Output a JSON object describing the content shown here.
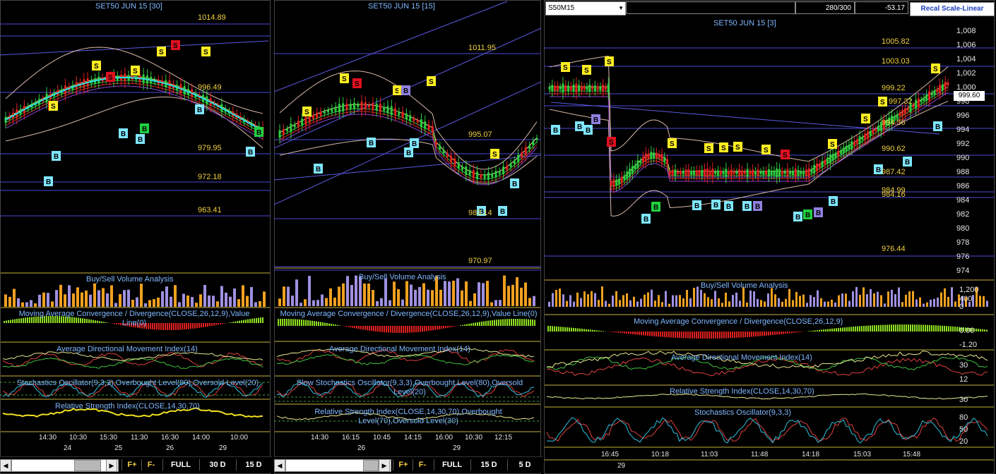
{
  "panes": [
    {
      "title": "SET50 JUN 15  [30]",
      "levels": [
        "1014.89",
        "996.49",
        "979.95",
        "972.18",
        "963.41"
      ],
      "indicators": {
        "volume": "Buy/Sell Volume Analysis",
        "macd": "Moving Average Convergence / Divergence(CLOSE,26,12,9),Value Line(0)",
        "adx": "Average Directional Movement Index(14)",
        "stoch": "Stochastics Oscillator(9,3,3),Overbought Level(80),Oversold Level(20)",
        "rsi": "Relative Strength Index(CLOSE,14,30,70)"
      },
      "times": [
        "14:30",
        "10:30",
        "15:30",
        "11:30",
        "16:30",
        "14:00",
        "10:00"
      ],
      "dates": [
        "24",
        "25",
        "26",
        "29"
      ],
      "toolbar": [
        "FULL",
        "30 D",
        "15 D"
      ]
    },
    {
      "title": "SET50 JUN 15  [15]",
      "levels": [
        "1011.95",
        "995.07",
        "983.14",
        "970.97"
      ],
      "indicators": {
        "volume": "Buy/Sell Volume Analysis",
        "macd": "Moving Average Convergence / Divergence(CLOSE,26,12,9),Value Line(0)",
        "adx": "Average Directional Movement Index(14)",
        "stoch": "Slow Stochastics Oscillator(9,3,3),Overbought Level(80),Oversold Level(20)",
        "rsi": "Relative Strength Index(CLOSE,14,30,70),Overbought Level(70),Oversold Level(30)"
      },
      "times": [
        "14:30",
        "16:15",
        "10:45",
        "14:15",
        "16:00",
        "10:30",
        "12:15"
      ],
      "dates": [
        "26",
        "29"
      ],
      "toolbar": [
        "FULL",
        "15 D",
        "5 D"
      ]
    },
    {
      "title": "SET50 JUN 15  [3]",
      "levels": [
        "1005.82",
        "1003.03",
        "999.22",
        "997.32",
        "994.36",
        "990.62",
        "987.42",
        "984.99",
        "984.16",
        "976.44"
      ],
      "indicators": {
        "volume": "Buy/Sell Volume Analysis",
        "macd": "Moving Average Convergence / Divergence(CLOSE,26,12,9)",
        "adx": "Average Directional Movement Index(14)",
        "rsi": "Relative Strength Index(CLOSE,14,30,70)",
        "stoch": "Stochastics Oscillator(9,3,3)"
      },
      "times": [
        "16:45",
        "10:18",
        "11:03",
        "11:48",
        "14:18",
        "15:03",
        "15:48"
      ],
      "dates": [
        "29"
      ],
      "price_axis": [
        "1,008",
        "1,006",
        "1,004",
        "1,002",
        "1,000",
        "998",
        "996",
        "994",
        "992",
        "990",
        "988",
        "986",
        "984",
        "982",
        "980",
        "978",
        "976",
        "974"
      ],
      "volume_axis": [
        "1,200",
        "400",
        "0"
      ],
      "macd_axis": [
        "0.00",
        "-1.20"
      ],
      "adx_axis": [
        "30",
        "12"
      ],
      "rsi_axis": [
        "30"
      ],
      "stoch_axis": [
        "80",
        "50",
        "20"
      ],
      "last_price": "999.60"
    }
  ],
  "header": {
    "symbol": "S50M15",
    "counter": "280/300",
    "change": "-53.17",
    "recal_label": "Recal Scale-Linear"
  },
  "toolbar_f": [
    "F+",
    "F-"
  ],
  "colors": {
    "background": "#000000",
    "title": "#7fb8ff",
    "level": "#f0d040",
    "bull_candle": "#2ecc40",
    "bear_candle": "#e02020",
    "buy_marker": "#7fe6ff",
    "sell_marker": "#ffee22"
  }
}
